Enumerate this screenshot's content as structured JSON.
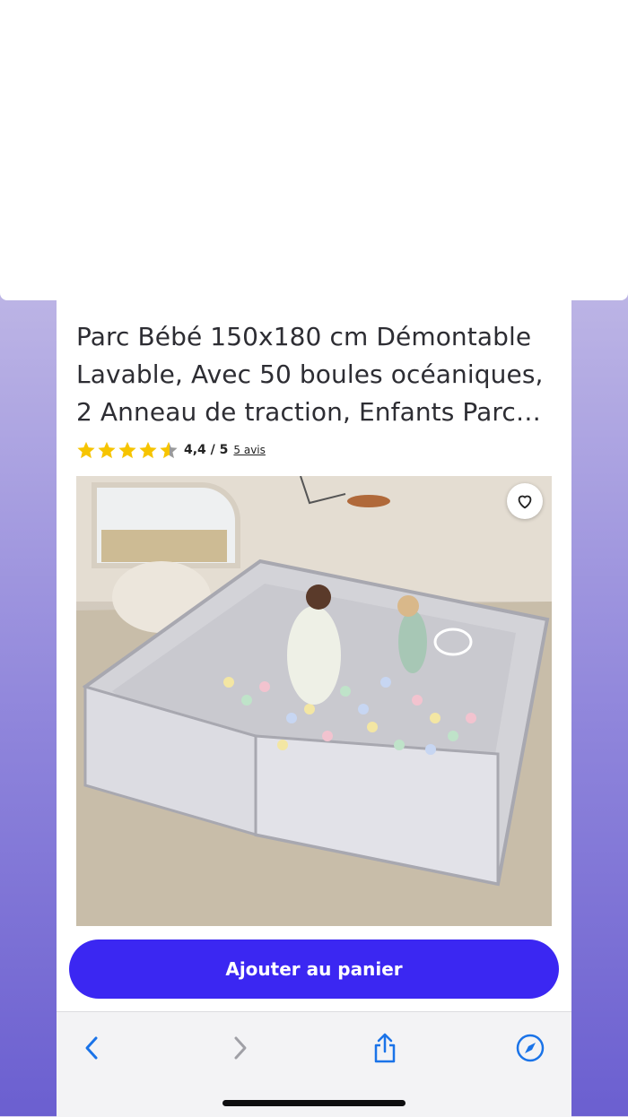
{
  "product": {
    "title_lines": [
      "Parc Bébé 150x180 cm Démontable",
      "Lavable, Avec 50 boules océaniques,",
      "2 Anneau de traction, Enfants Parc…"
    ],
    "rating": {
      "score": 4.4,
      "score_text": "4,4 / 5",
      "reviews_text": "5 avis",
      "star_color": "#f6c400"
    }
  },
  "image": {
    "alt": "product photo - baby playpen with colored balls"
  },
  "actions": {
    "add_to_cart": "Ajouter au panier",
    "accent": "#3b27f2"
  },
  "toolbar": {
    "icons": [
      "chevron-left-icon",
      "chevron-right-icon",
      "share-icon",
      "compass-icon"
    ],
    "icon_color": "#1a73e8"
  }
}
